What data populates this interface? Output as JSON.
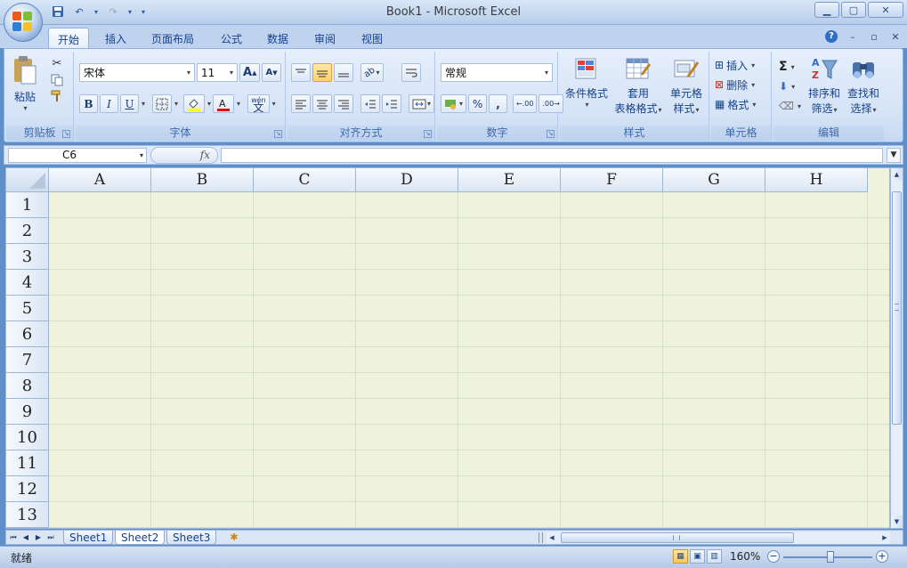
{
  "window": {
    "title": "Book1 - Microsoft Excel"
  },
  "window_controls": {
    "minimize": "▁",
    "restore": "▢",
    "close": "✕"
  },
  "ribbon_tabs": [
    "开始",
    "插入",
    "页面布局",
    "公式",
    "数据",
    "审阅",
    "视图"
  ],
  "active_tab": "开始",
  "ribbon": {
    "clipboard": {
      "paste_label": "粘贴",
      "group_label": "剪贴板"
    },
    "font": {
      "font_name": "宋体",
      "font_size": "11",
      "group_label": "字体",
      "bold": "B",
      "italic": "I",
      "underline": "U",
      "grow": "A",
      "shrink": "A",
      "phonetic": "wén"
    },
    "alignment": {
      "group_label": "对齐方式"
    },
    "number": {
      "format": "常规",
      "percent": "%",
      "comma": ",",
      "group_label": "数字",
      "inc_decimal": ".00",
      "dec_decimal": ".00"
    },
    "styles": {
      "conditional_format": "条件格式",
      "table_format_line1": "套用",
      "table_format_line2": "表格格式",
      "cell_style_line1": "单元格",
      "cell_style_line2": "样式",
      "group_label": "样式"
    },
    "cells": {
      "insert": "插入",
      "delete": "删除",
      "format": "格式",
      "group_label": "单元格"
    },
    "editing": {
      "sum": "Σ",
      "sort_line1": "排序和",
      "sort_line2": "筛选",
      "find_line1": "查找和",
      "find_line2": "选择",
      "group_label": "编辑"
    }
  },
  "formula_bar": {
    "name_box": "C6",
    "fx": "fx",
    "formula": ""
  },
  "grid": {
    "columns": [
      "A",
      "B",
      "C",
      "D",
      "E",
      "F",
      "G",
      "H"
    ],
    "rows": [
      "1",
      "2",
      "3",
      "4",
      "5",
      "6",
      "7",
      "8",
      "9",
      "10",
      "11",
      "12",
      "13"
    ]
  },
  "sheets": [
    "Sheet1",
    "Sheet2",
    "Sheet3"
  ],
  "active_sheet": "Sheet2",
  "status": {
    "ready": "就绪",
    "zoom": "160%"
  },
  "colors": {
    "accent": "#15428b",
    "ribbon_bg": "#d5e3f6",
    "grid_bg": "#f0f3dc",
    "highlight": "#ffcf6b"
  },
  "icons": [
    "office-button-icon",
    "save-icon",
    "undo-icon",
    "redo-icon",
    "help-icon",
    "paste-icon",
    "cut-icon",
    "copy-icon",
    "format-painter-icon",
    "borders-icon",
    "fill-color-icon",
    "font-color-icon",
    "conditional-format-icon",
    "table-format-icon",
    "cell-styles-icon",
    "sum-icon",
    "fill-icon",
    "clear-icon",
    "sort-filter-icon",
    "find-icon"
  ]
}
